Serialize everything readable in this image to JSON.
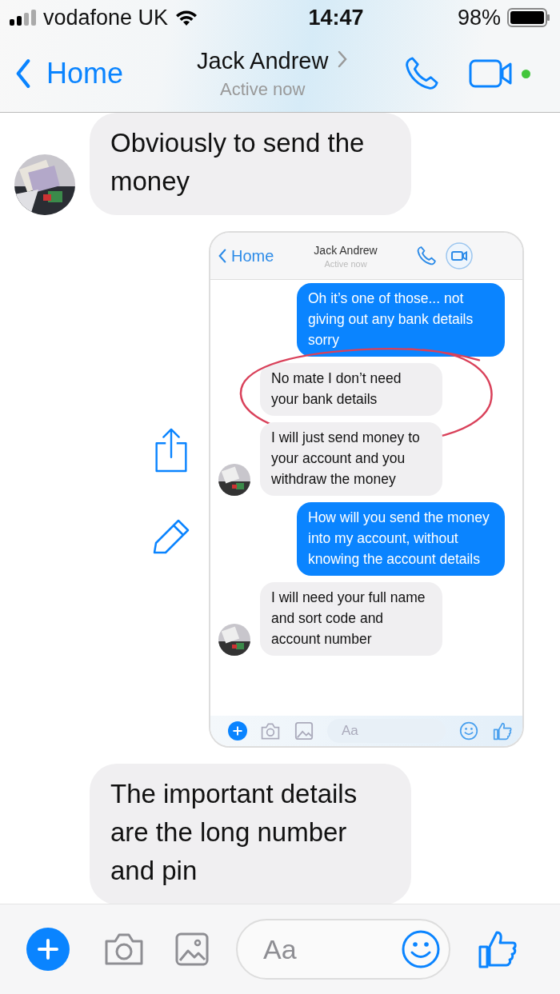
{
  "status_bar": {
    "carrier": "vodafone UK",
    "time": "14:47",
    "battery": "98%"
  },
  "header": {
    "back": "Home",
    "title": "Jack Andrew",
    "subtitle": "Active now",
    "online": true
  },
  "messages": [
    {
      "kind": "text",
      "sent": false,
      "avatar": true,
      "text": "Obviously to send the money"
    },
    {
      "kind": "screenshot",
      "screenshot": {
        "header": {
          "back": "Home",
          "title": "Jack Andrew",
          "subtitle": "Active now"
        },
        "messages": [
          {
            "sent": true,
            "avatar": false,
            "circled": false,
            "text": "Oh it’s one of those... not giving out any bank details sorry"
          },
          {
            "sent": false,
            "avatar": false,
            "circled": true,
            "text": "No mate I don’t need your bank details"
          },
          {
            "sent": false,
            "avatar": true,
            "circled": false,
            "text": "I will just send money to your account and you withdraw the money"
          },
          {
            "sent": true,
            "avatar": false,
            "circled": false,
            "text": "How will you send the money into my account, without knowing the account details"
          },
          {
            "sent": false,
            "avatar": true,
            "circled": false,
            "text": "I will need your full name and sort code and account number"
          }
        ],
        "composer": {
          "placeholder": "Aa"
        }
      }
    },
    {
      "kind": "text",
      "sent": false,
      "avatar": false,
      "text": "The important details are the long number and pin"
    }
  ],
  "composer": {
    "placeholder": "Aa"
  }
}
